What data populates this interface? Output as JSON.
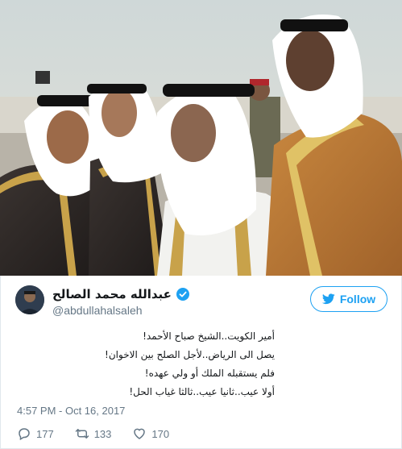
{
  "author": {
    "display_name": "عبدالله محمد الصالح",
    "handle": "@abdullahalsaleh",
    "verified": true
  },
  "follow_button": {
    "label": "Follow",
    "icon": "twitter-bird-icon"
  },
  "tweet": {
    "lines": [
      "أمير الكويت..الشيخ صباح الأحمد!",
      "يصل الى الرياض..لأجل الصلح بين الاخوان!",
      "فلم يستقبله الملك أو ولي عهده!",
      "أولا عيب..ثانيا عيب..ثالثا غياب الحل!"
    ],
    "timestamp": "4:57 PM - Oct 16, 2017"
  },
  "actions": {
    "replies": "177",
    "retweets": "133",
    "likes": "170"
  },
  "colors": {
    "accent": "#1da1f2",
    "secondary_text": "#657786"
  }
}
